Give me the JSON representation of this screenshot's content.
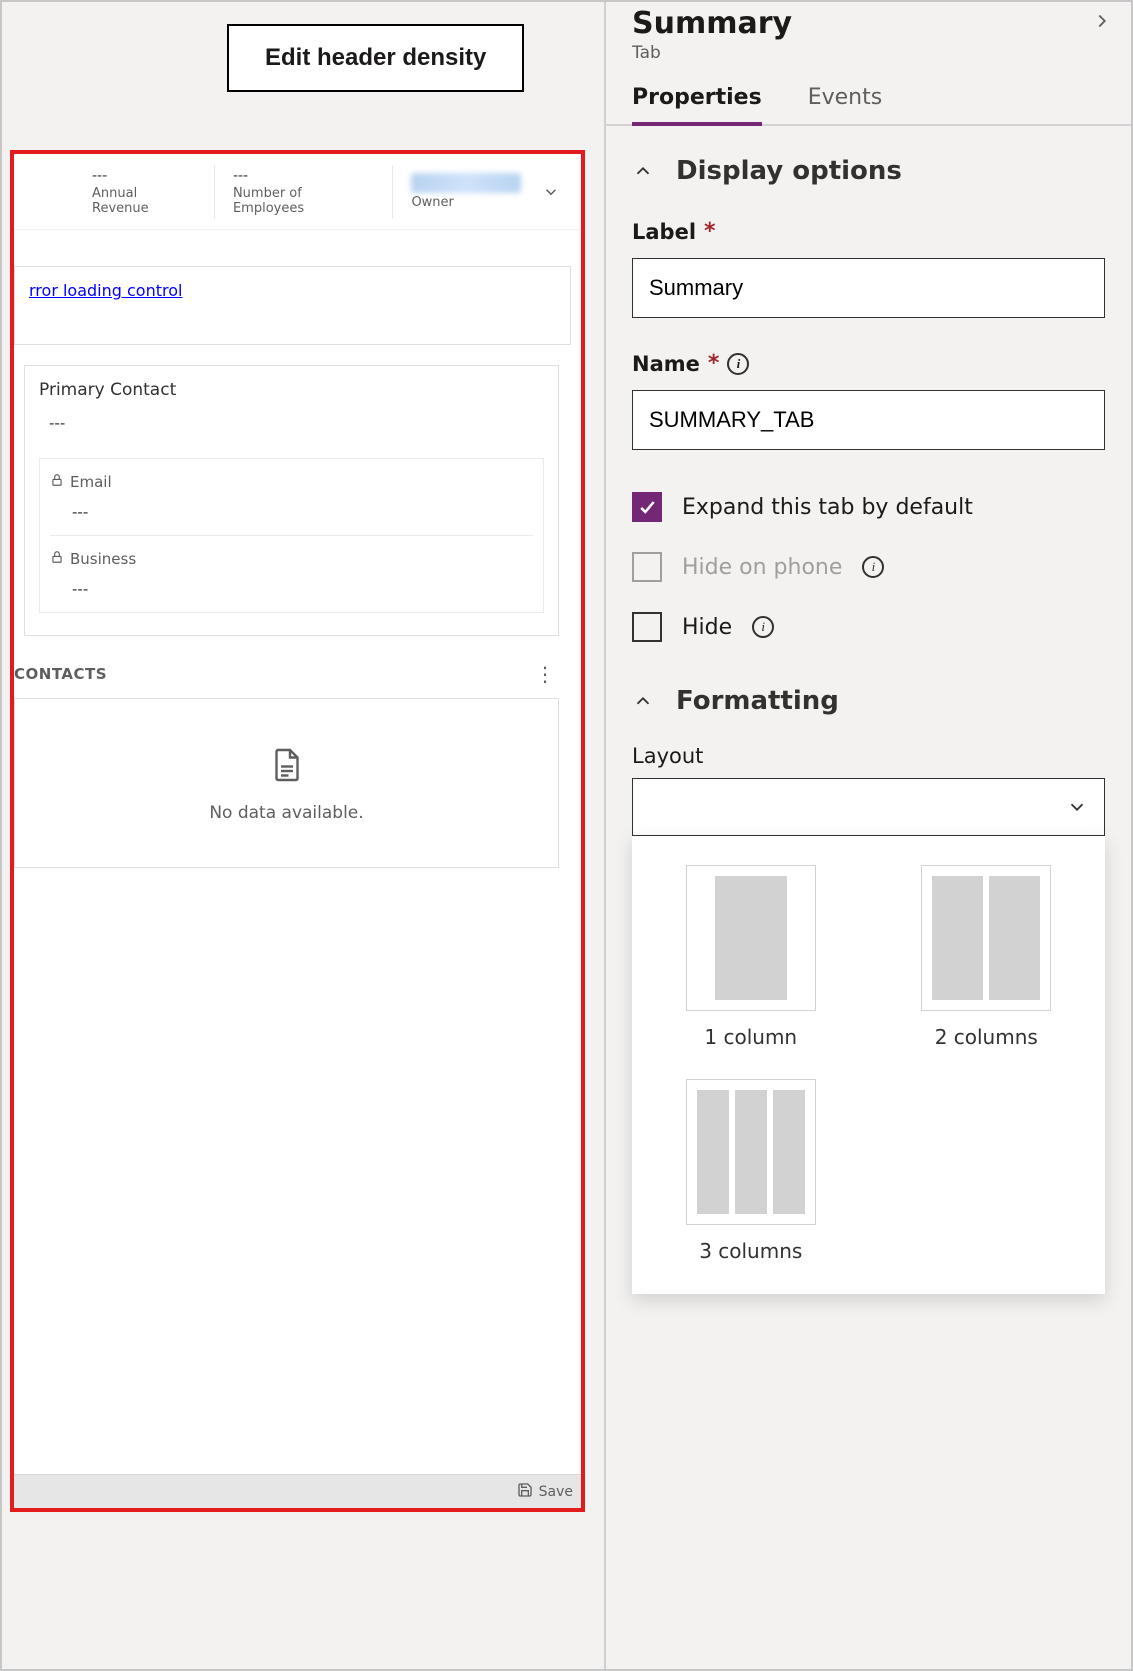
{
  "left": {
    "edit_header_button": "Edit header density",
    "header_fields": [
      {
        "value": "---",
        "label": "Annual Revenue"
      },
      {
        "value": "---",
        "label": "Number of Employees"
      },
      {
        "value": "",
        "label": "Owner"
      }
    ],
    "error_link_text": "rror loading control",
    "primary_contact": {
      "title": "Primary Contact",
      "value": "---",
      "email_label": "Email",
      "email_value": "---",
      "business_label": "Business",
      "business_value": "---"
    },
    "contacts_title": "CONTACTS",
    "empty_text": "No data available.",
    "save_label": "Save"
  },
  "right": {
    "title": "Summary",
    "subtitle": "Tab",
    "tabs": {
      "properties": "Properties",
      "events": "Events"
    },
    "display_options_title": "Display options",
    "label_field_label": "Label",
    "label_value": "Summary",
    "name_field_label": "Name",
    "name_value": "SUMMARY_TAB",
    "expand_checkbox": "Expand this tab by default",
    "hide_phone_checkbox": "Hide on phone",
    "hide_checkbox": "Hide",
    "formatting_title": "Formatting",
    "layout_label": "Layout",
    "layout_options": {
      "one": "1 column",
      "two": "2 columns",
      "three": "3 columns"
    }
  }
}
